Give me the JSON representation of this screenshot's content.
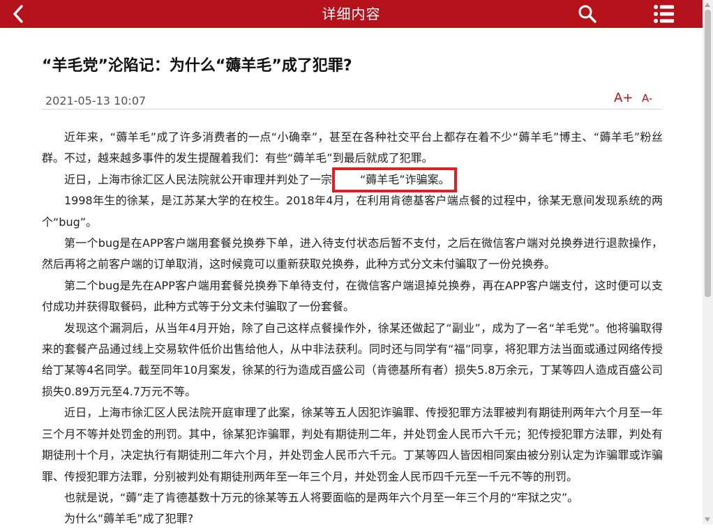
{
  "header": {
    "title": "详细内容",
    "back_icon": "chevron-left-icon",
    "search_icon": "search-icon",
    "menu_icon": "list-menu-icon",
    "bar_color": "#b5121b"
  },
  "article": {
    "headline": "“羊毛党”沦陷记：为什么“薅羊毛”成了犯罪?",
    "date": "2021-05-13 10:07",
    "font_increase_label": "A+",
    "font_decrease_label": "A-",
    "p1": "近年来，“薅羊毛”成了许多消费者的一点“小确幸”，甚至在各种社交平台上都存在着不少“薅羊毛”博主、“薅羊毛”粉丝群。不过，越来越多事件的发生提醒着我们：有些“薅羊毛”到最后就成了犯罪。",
    "p2_before": "近日，上海市徐汇区人民法院就公开审理并判处了一宗",
    "p2_highlight": "“薅羊毛”诈骗案。",
    "p3": "1998年生的徐某，是江苏某大学的在校生。2018年4月，在利用肯德基客户端点餐的过程中，徐某无意间发现系统的两个“bug”。",
    "p4": "第一个bug是在APP客户端用套餐兑换券下单，进入待支付状态后暂不支付，之后在微信客户端对兑换券进行退款操作，然后再将之前客户端的订单取消，这时候竟可以重新获取兑换券，此种方式分文未付骗取了一份兑换券。",
    "p5": "第二个bug是先在APP客户端用套餐兑换券下单待支付，在微信客户端退掉兑换券，再在APP客户端支付，这时便可以支付成功并获得取餐码，此种方式等于分文未付骗取了一份套餐。",
    "p6": "发现这个漏洞后，从当年4月开始，除了自己这样点餐操作外，徐某还做起了“副业”，成为了一名“羊毛党”。他将骗取得来的套餐产品通过线上交易软件低价出售给他人，从中非法获利。同时还与同学有“福”同享，将犯罪方法当面或通过网络传授给丁某等4名同学。截至同年10月案发，徐某的行为造成百盛公司（肯德基所有者）损失5.8万余元，丁某等四人造成百盛公司损失0.89万元至4.7万元不等。",
    "p7": "近日，上海市徐汇区人民法院开庭审理了此案，徐某等五人因犯诈骗罪、传授犯罪方法罪被判有期徒刑两年六个月至一年三个月不等并处罚金的刑罚。其中，徐某犯诈骗罪，判处有期徒刑二年，并处罚金人民币六千元；犯传授犯罪方法罪，判处有期徒刑十个月，决定执行有期徒刑二年六个月，并处罚金人民币六千元。丁某等四人皆因相同案由被分别认定为诈骗罪或诈骗罪、传授犯罪方法罪，分别被判处有期徒刑两年至一年三个月，并处罚金人民币四千元至一千元不等的刑罚。",
    "p8": "也就是说，“薅”走了肯德基数十万元的徐某等五人将要面临的是两年六个月至一年三个月的“牢狱之灾”。",
    "p9": "为什么“薅羊毛”成了犯罪?"
  },
  "highlight_color": "#e02020"
}
